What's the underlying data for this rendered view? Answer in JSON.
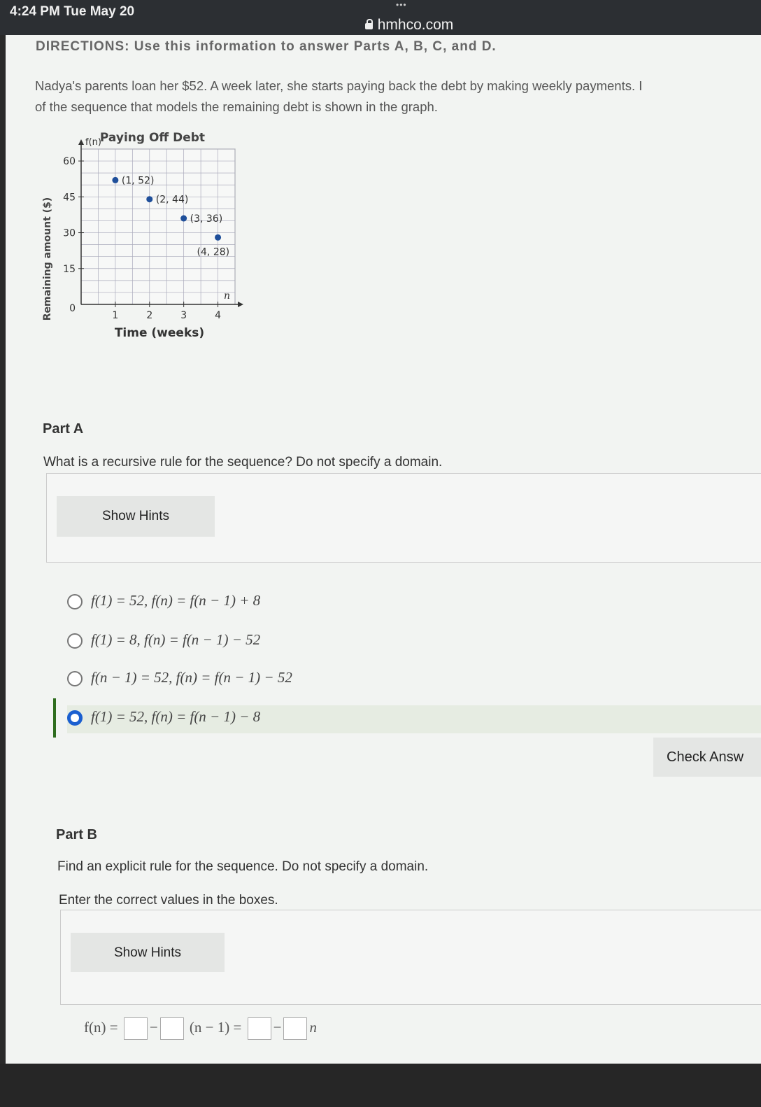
{
  "status": {
    "time": "4:24 PM  Tue May 20",
    "url": "hmhco.com",
    "dots": "•••"
  },
  "directions": "DIRECTIONS: Use this information to answer Parts A, B, C, and D.",
  "intro": {
    "line1": "Nadya's parents loan her $52. A week later, she starts paying back the debt by making weekly payments. I",
    "line2": "of the sequence that models the remaining debt is shown in the graph."
  },
  "chart_data": {
    "type": "scatter",
    "title": "Paying Off Debt",
    "xlabel": "Time (weeks)",
    "ylabel": "Remaining amount ($)",
    "x_var": "n",
    "y_var": "f(n)",
    "xlim": [
      0,
      4.5
    ],
    "ylim": [
      0,
      65
    ],
    "xticks": [
      1,
      2,
      3,
      4
    ],
    "yticks": [
      0,
      15,
      30,
      45,
      60
    ],
    "grid": true,
    "points": [
      {
        "x": 1,
        "y": 52,
        "label": "(1, 52)"
      },
      {
        "x": 2,
        "y": 44,
        "label": "(2, 44)"
      },
      {
        "x": 3,
        "y": 36,
        "label": "(3, 36)"
      },
      {
        "x": 4,
        "y": 28,
        "label": "(4, 28)"
      }
    ]
  },
  "partA": {
    "title": "Part A",
    "question": "What is a recursive rule for the sequence? Do not specify a domain.",
    "hint_label": "Show Hints",
    "options": [
      "f(1) = 52, f(n) = f(n − 1) + 8",
      "f(1) = 8, f(n) = f(n − 1) − 52",
      "f(n − 1) = 52, f(n) = f(n − 1) − 52",
      "f(1) = 52, f(n) = f(n − 1) − 8"
    ],
    "selected_index": 3,
    "check_label": "Check Answ"
  },
  "partB": {
    "title": "Part B",
    "question": "Find an explicit rule for the sequence. Do not specify a domain.",
    "instruction": "Enter the correct values in the boxes.",
    "hint_label": "Show Hints",
    "formula": {
      "lhs": "f(n) =",
      "minus": "−",
      "mid": "(n − 1) =",
      "tail": "n"
    }
  }
}
